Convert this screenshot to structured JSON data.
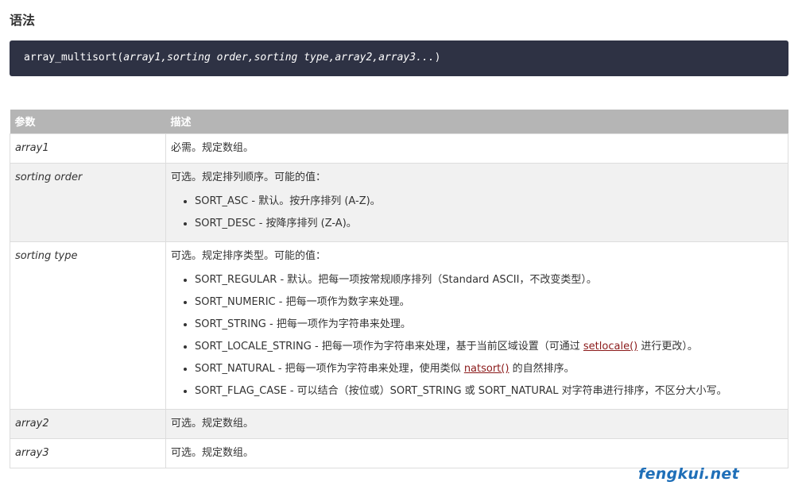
{
  "heading": "语法",
  "code": {
    "fn": "array_multisort(",
    "args": "array1,sorting order,sorting type,array2,array3...",
    "close": ")"
  },
  "table": {
    "headers": [
      "参数",
      "描述"
    ],
    "rows": {
      "array1": {
        "name": "array1",
        "desc": "必需。规定数组。"
      },
      "sorting_order": {
        "name": "sorting order",
        "desc": "可选。规定排列顺序。可能的值：",
        "values": [
          "SORT_ASC - 默认。按升序排列 (A-Z)。",
          "SORT_DESC - 按降序排列 (Z-A)。"
        ]
      },
      "sorting_type": {
        "name": "sorting type",
        "desc": "可选。规定排序类型。可能的值：",
        "values": {
          "regular": "SORT_REGULAR - 默认。把每一项按常规顺序排列（Standard ASCII，不改变类型）。",
          "numeric": "SORT_NUMERIC - 把每一项作为数字来处理。",
          "string": "SORT_STRING - 把每一项作为字符串来处理。",
          "locale_pre": "SORT_LOCALE_STRING - 把每一项作为字符串来处理，基于当前区域设置（可通过 ",
          "locale_link": "setlocale()",
          "locale_post": " 进行更改）。",
          "natural_pre": "SORT_NATURAL - 把每一项作为字符串来处理，使用类似 ",
          "natural_link": "natsort()",
          "natural_post": " 的自然排序。",
          "flag_case": "SORT_FLAG_CASE - 可以结合（按位或）SORT_STRING 或 SORT_NATURAL 对字符串进行排序，不区分大小写。"
        }
      },
      "array2": {
        "name": "array2",
        "desc": "可选。规定数组。"
      },
      "array3": {
        "name": "array3",
        "desc": "可选。规定数组。"
      }
    }
  },
  "watermark": "fengkui.net"
}
